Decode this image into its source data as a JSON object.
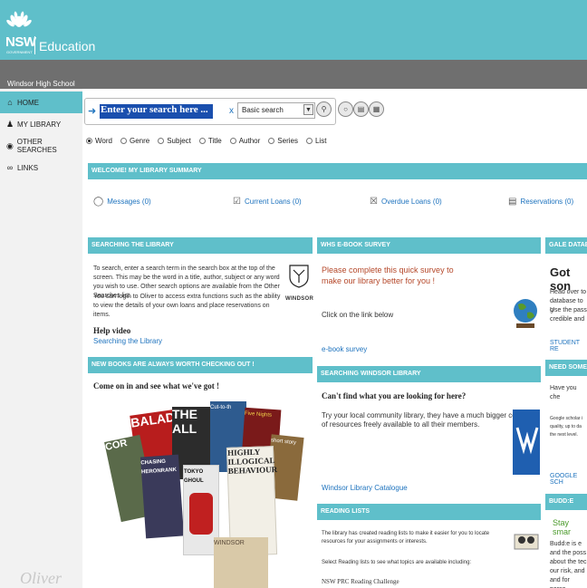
{
  "header": {
    "logo_text": "NSW",
    "logo_subtext": "GOVERNMENT",
    "title": "Education",
    "school": "Windsor High School"
  },
  "sidebar": {
    "items": [
      {
        "label": "HOME",
        "icon": "home-icon"
      },
      {
        "label": "MY LIBRARY",
        "icon": "person-icon"
      },
      {
        "label": "OTHER SEARCHES",
        "icon": "binoculars-icon"
      },
      {
        "label": "LINKS",
        "icon": "link-icon"
      }
    ],
    "footer_logo": "Oliver"
  },
  "search": {
    "value": "Enter your search here ...",
    "clear": "x",
    "type_selected": "Basic search",
    "options": [
      "Word",
      "Genre",
      "Subject",
      "Title",
      "Author",
      "Series",
      "List"
    ],
    "selected_option": "Word"
  },
  "summary": {
    "title": "WELCOME! MY LIBRARY SUMMARY",
    "items": [
      {
        "label": "Messages",
        "count": "(0)",
        "icon": "message-icon"
      },
      {
        "label": "Current Loans",
        "count": "(0)",
        "icon": "loans-icon"
      },
      {
        "label": "Overdue Loans",
        "count": "(0)",
        "icon": "overdue-icon"
      },
      {
        "label": "Reservations",
        "count": "(0)",
        "icon": "reservation-icon"
      }
    ]
  },
  "panels": {
    "searching": {
      "title": "SEARCHING THE LIBRARY",
      "text1": "To search, enter a search term in the search box at the top of the screen.  This may be the word in a title, author, subject or any word you wish to use.  Other search options are available from the Other Searches list.",
      "text2": "You can login to Oliver to access extra functions such as the ability to view the details of your own loans and place reservations on items.",
      "help_title": "Help video",
      "help_link": "Searching the Library",
      "crest_text": "WINDSOR"
    },
    "new_books": {
      "title": "NEW BOOKS ARE ALWAYS WORTH CHECKING OUT !",
      "subtitle": "Come on in and see what we've got !"
    },
    "ebook": {
      "title": "WHS E-BOOK SURVEY",
      "headline": "Please complete this quick survey to make our library better for you !",
      "text": "Click on the link below",
      "link": "e-book survey"
    },
    "windsor": {
      "title": "SEARCHING WINDSOR LIBRARY",
      "subtitle": "Can't find what you are looking for here?",
      "text": "Try your local community library, they have a much bigger collection of resources freely available to all their members.",
      "link": "Windsor Library Catalogue"
    },
    "reading": {
      "title": "READING LISTS",
      "text1": "The library has created reading lists to make it easier for you to locate resources for your assignments or interests.",
      "text2": "Select Reading lists to see what topics are available including:",
      "text3": "NSW PRC Reading Challenge"
    },
    "gale": {
      "title": "GALE DATABA",
      "headline": "Got son",
      "lines": [
        "Head over to",
        "database to g",
        "Use the pass",
        "credible and"
      ],
      "link": "STUDENT RE"
    },
    "need": {
      "title": "NEED SOME G",
      "text": "Have you che",
      "lines": [
        "Google scholar i",
        "quality, up to da",
        "the next level."
      ],
      "link": "GOOGLE SCH"
    },
    "budde": {
      "title": "BUDD:E",
      "headline": "Stay smar",
      "lines": [
        "Budd:e is e",
        "and the poss",
        "about the tec",
        "our risk, and",
        "and for perso"
      ]
    }
  },
  "books": [
    {
      "title": "BALAD",
      "color": "#b81d1d"
    },
    {
      "title": "THE ALL",
      "color": "#2c2c2c"
    },
    {
      "title": "Cut-to-th",
      "color": "#2e5b8f"
    },
    {
      "title": "Five Nights",
      "color": "#7a1a1a"
    },
    {
      "title": "short story",
      "color": "#8a6a3c"
    },
    {
      "title": "COR",
      "color": "#5a6a4a"
    },
    {
      "title": "CHASING HERONRANK",
      "color": "#3a3a5a"
    },
    {
      "title": "TOKYO GHOUL",
      "color": "#e8e8e8"
    },
    {
      "title": "HIGHLY ILLOGICAL BEHAVIOUR",
      "color": "#f2efe6"
    },
    {
      "title": "WINDSOR",
      "color": "#d9c9a8"
    }
  ],
  "colors": {
    "teal": "#5fbfca",
    "header_gray": "#6f6f6f",
    "link_blue": "#1e73be",
    "search_highlight": "#1a4fae",
    "survey_red": "#b5482a",
    "stay_green": "#4a9a2a"
  }
}
